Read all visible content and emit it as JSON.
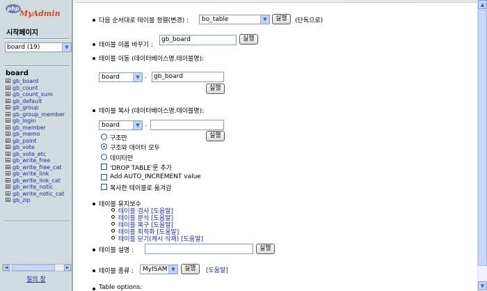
{
  "left_frame": {
    "logo": {
      "php": "php",
      "myadmin": "MyAdmin"
    },
    "home_link": "시작페이지",
    "db_select_value": "board (19)",
    "db_name": "board",
    "tables": [
      "gb_board",
      "gb_count",
      "gb_count_sum",
      "gb_default",
      "gb_group",
      "gb_group_member",
      "gb_login",
      "gb_member",
      "gb_memo",
      "gb_point",
      "gb_vote",
      "gb_vote_etc",
      "gb_write_free",
      "gb_write_free_cat",
      "gb_write_link",
      "gb_write_link_cat",
      "gb_write_notic",
      "gb_write_notic_cat",
      "gb_zip"
    ],
    "query_window_link": "질의 창"
  },
  "operations": {
    "order": {
      "label": "다음 순서대로 테이블 정렬(변경) :",
      "select_value": "bo_table",
      "button": "실행",
      "suffix": "(단독으로)"
    },
    "rename": {
      "label": "테이블 이름 바꾸기 :",
      "input_value": "gb_board",
      "button": "실행"
    },
    "move": {
      "label": "테이블 이동 (데이터베이스명.테이블명):",
      "db_value": "board",
      "dot": ".",
      "table_value": "gb_board",
      "button": "실행"
    },
    "copy": {
      "label": "테이블 복사 (데이터베이스명.테이블명):",
      "db_value": "board",
      "dot": ".",
      "table_value": "",
      "button": "실행",
      "radios": [
        {
          "label": "구조만",
          "checked": false
        },
        {
          "label": "구조와 데이터 모두",
          "checked": true
        },
        {
          "label": "데이터만",
          "checked": false
        }
      ],
      "checkboxes": [
        {
          "label": "'DROP TABLE'문 추가"
        },
        {
          "label": "Add AUTO_INCREMENT value"
        },
        {
          "label": "복사한 테이블로 옮겨감"
        }
      ]
    },
    "maintenance": {
      "label": "테이블 유지보수",
      "items": [
        {
          "label": "테이블 검사",
          "help": "[도움말]"
        },
        {
          "label": "테이블 분석",
          "help": "[도움말]"
        },
        {
          "label": "테이블 복구",
          "help": "[도움말]"
        },
        {
          "label": "테이블 최적화",
          "help": "[도움말]"
        },
        {
          "label": "테이블 닫기(캐시 삭제)",
          "help": "[도움말]"
        }
      ]
    },
    "comment": {
      "label": "테이블 설명 :",
      "input_value": "",
      "button": "실행"
    },
    "engine": {
      "label": "테이블 종류 :",
      "select_value": "MyISAM",
      "button": "실행",
      "help": "[도움말]"
    },
    "table_options": {
      "label": "Table options:"
    }
  }
}
